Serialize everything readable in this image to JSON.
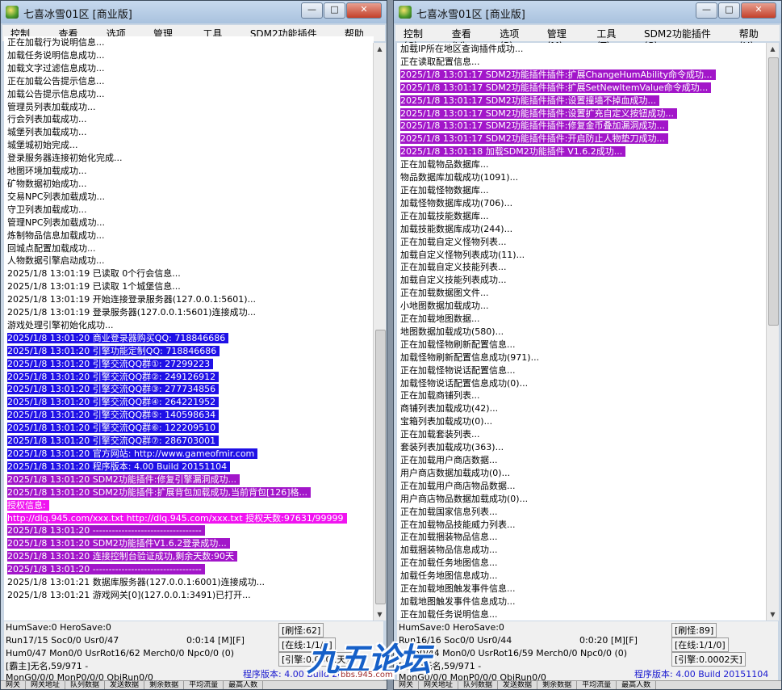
{
  "windows": [
    {
      "title": "七喜冰雪01区 [商业版]",
      "menu": [
        "控制(C)",
        "查看(V)",
        "选项(P)",
        "管理(M)",
        "工具(T)",
        "SDM2功能插件(S)",
        "帮助(H)"
      ],
      "menu_underline": [
        "C",
        "V",
        "P",
        "M",
        "T",
        "S",
        "H"
      ],
      "log": [
        {
          "t": "正在加载行为说明信息...",
          "c": ""
        },
        {
          "t": "加载任务说明信息成功...",
          "c": ""
        },
        {
          "t": "加载文字过滤信息成功...",
          "c": ""
        },
        {
          "t": "正在加载公告提示信息...",
          "c": ""
        },
        {
          "t": "加载公告提示信息成功...",
          "c": ""
        },
        {
          "t": "管理员列表加载成功...",
          "c": ""
        },
        {
          "t": "行会列表加载成功...",
          "c": ""
        },
        {
          "t": "城堡列表加载成功...",
          "c": ""
        },
        {
          "t": "城堡城初始完成...",
          "c": ""
        },
        {
          "t": "登录服务器连接初始化完成...",
          "c": ""
        },
        {
          "t": "地图环境加载成功...",
          "c": ""
        },
        {
          "t": "矿物数据初始成功...",
          "c": ""
        },
        {
          "t": "交易NPC列表加载成功...",
          "c": ""
        },
        {
          "t": "守卫列表加载成功...",
          "c": ""
        },
        {
          "t": "管理NPC列表加载成功...",
          "c": ""
        },
        {
          "t": "炼制物品信息加载成功...",
          "c": ""
        },
        {
          "t": "回城点配置加载成功...",
          "c": ""
        },
        {
          "t": "人物数据引擎启动成功...",
          "c": ""
        },
        {
          "t": "2025/1/8 13:01:19 已读取 0个行会信息...",
          "c": ""
        },
        {
          "t": "2025/1/8 13:01:19 已读取 1个城堡信息...",
          "c": ""
        },
        {
          "t": "2025/1/8 13:01:19 开始连接登录服务器(127.0.0.1:5601)...",
          "c": ""
        },
        {
          "t": "2025/1/8 13:01:19 登录服务器(127.0.0.1:5601)连接成功...",
          "c": ""
        },
        {
          "t": "游戏处理引擎初始化成功...",
          "c": ""
        },
        {
          "t": "2025/1/8 13:01:20 商业登录器购买QQ: 718846686",
          "c": "hl-blue"
        },
        {
          "t": "2025/1/8 13:01:20 引擎功能定制QQ: 718846686",
          "c": "hl-blue"
        },
        {
          "t": "2025/1/8 13:01:20 引擎交流QQ群①: 27299223",
          "c": "hl-blue"
        },
        {
          "t": "2025/1/8 13:01:20 引擎交流QQ群②: 249126912",
          "c": "hl-blue"
        },
        {
          "t": "2025/1/8 13:01:20 引擎交流QQ群③: 277734856",
          "c": "hl-blue"
        },
        {
          "t": "2025/1/8 13:01:20 引擎交流QQ群④: 264221952",
          "c": "hl-blue"
        },
        {
          "t": "2025/1/8 13:01:20 引擎交流QQ群⑤: 140598634",
          "c": "hl-blue"
        },
        {
          "t": "2025/1/8 13:01:20 引擎交流QQ群⑥: 122209510",
          "c": "hl-blue"
        },
        {
          "t": "2025/1/8 13:01:20 引擎交流QQ群⑦: 286703001",
          "c": "hl-blue"
        },
        {
          "t": "2025/1/8 13:01:20 官方网站: http://www.gameofmir.com",
          "c": "hl-blue"
        },
        {
          "t": "2025/1/8 13:01:20 程序版本: 4.00 Build 20151104",
          "c": "hl-blue"
        },
        {
          "t": "2025/1/8 13:01:20 SDM2功能插件:修复引擎漏洞成功...",
          "c": "hl-purple"
        },
        {
          "t": "2025/1/8 13:01:20 SDM2功能插件:扩展背包加载成功,当前背包[126]格...",
          "c": "hl-purple"
        },
        {
          "t": "授权信息:",
          "c": "hl-magenta"
        },
        {
          "t": "http://dlq.945.com/xxx.txt http://dlq.945.com/xxx.txt 授权天数:97631/99999",
          "c": "hl-magenta"
        },
        {
          "t": "2025/1/8 13:01:20 ----------------------------------",
          "c": "hl-purple"
        },
        {
          "t": "2025/1/8 13:01:20 SDM2功能插件V1.6.2登录成功...",
          "c": "hl-purple"
        },
        {
          "t": "2025/1/8 13:01:20 连接控制台验证成功,剩余天数:90天",
          "c": "hl-purple"
        },
        {
          "t": "2025/1/8 13:01:20 ----------------------------------",
          "c": "hl-purple"
        },
        {
          "t": "2025/1/8 13:01:21 数据库服务器(127.0.0.1:6001)连接成功...",
          "c": ""
        },
        {
          "t": "2025/1/8 13:01:21 游戏网关[0](127.0.0.1:3491)已打开...",
          "c": ""
        }
      ],
      "status": {
        "line1": "HumSave:0 HeroSave:0",
        "line2a": "Run17/15 Soc0/0 Usr0/47",
        "line2b": "0:0:14 [M][F]",
        "line3": "Hum0/47 Mon0/0 UsrRot16/62 Merch0/0 Npc0/0 (0)",
        "line4": "[霸主]无名,59/971 -",
        "line5": "MonG0/0/0 MonP0/0/0 ObjRun0/0",
        "box1": "[刷怪:62]",
        "box2": "[在线:1/1/0]",
        "box3": "[引擎:0.0002天]",
        "version": "程序版本: 4.00 Build 20151104"
      },
      "bottom": [
        "网关",
        "网关地址",
        "队列数据",
        "发送数据",
        "剩余数据",
        "平均流量",
        "最高人数"
      ]
    },
    {
      "title": "七喜冰雪01区 [商业版]",
      "menu": [
        "控制(C)",
        "查看(V)",
        "选项(P)",
        "管理(M)",
        "工具(T)",
        "SDM2功能插件(S)",
        "帮助(H)"
      ],
      "menu_underline": [
        "C",
        "V",
        "P",
        "M",
        "T",
        "S",
        "H"
      ],
      "log": [
        {
          "t": "加载IP所在地区查询插件成功...",
          "c": ""
        },
        {
          "t": "正在读取配置信息...",
          "c": ""
        },
        {
          "t": "2025/1/8 13:01:17 SDM2功能插件插件:扩展ChangeHumAbility命令成功...",
          "c": "hl-purple"
        },
        {
          "t": "2025/1/8 13:01:17 SDM2功能插件插件:扩展SetNewItemValue命令成功...",
          "c": "hl-purple"
        },
        {
          "t": "2025/1/8 13:01:17 SDM2功能插件插件:设置撞墙不掉血成功...",
          "c": "hl-purple"
        },
        {
          "t": "2025/1/8 13:01:17 SDM2功能插件插件:设置扩充自定义按钮成功...",
          "c": "hl-purple"
        },
        {
          "t": "2025/1/8 13:01:17 SDM2功能插件插件:修复金币叠加漏洞成功...",
          "c": "hl-purple"
        },
        {
          "t": "2025/1/8 13:01:17 SDM2功能插件插件:开启防止人物垫刀成功...",
          "c": "hl-purple"
        },
        {
          "t": "2025/1/8 13:01:18 加载SDM2功能插件 V1.6.2成功...",
          "c": "hl-purple"
        },
        {
          "t": "正在加载物品数据库...",
          "c": ""
        },
        {
          "t": "物品数据库加载成功(1091)...",
          "c": ""
        },
        {
          "t": "正在加载怪物数据库...",
          "c": ""
        },
        {
          "t": "加载怪物数据库成功(706)...",
          "c": ""
        },
        {
          "t": "正在加载技能数据库...",
          "c": ""
        },
        {
          "t": "加载技能数据库成功(244)...",
          "c": ""
        },
        {
          "t": "正在加载自定义怪物列表...",
          "c": ""
        },
        {
          "t": "加载自定义怪物列表成功(11)...",
          "c": ""
        },
        {
          "t": "正在加载自定义技能列表...",
          "c": ""
        },
        {
          "t": "加载自定义技能列表成功...",
          "c": ""
        },
        {
          "t": "正在加载数据图文件...",
          "c": ""
        },
        {
          "t": "小地图数据加载成功...",
          "c": ""
        },
        {
          "t": "正在加载地图数据...",
          "c": ""
        },
        {
          "t": "地图数据加载成功(580)...",
          "c": ""
        },
        {
          "t": "正在加载怪物刷新配置信息...",
          "c": ""
        },
        {
          "t": "加载怪物刷新配置信息成功(971)...",
          "c": ""
        },
        {
          "t": "正在加载怪物说话配置信息...",
          "c": ""
        },
        {
          "t": "加载怪物说话配置信息成功(0)...",
          "c": ""
        },
        {
          "t": "正在加载商铺列表...",
          "c": ""
        },
        {
          "t": "商铺列表加载成功(42)...",
          "c": ""
        },
        {
          "t": "宝箱列表加载成功(0)...",
          "c": ""
        },
        {
          "t": "正在加载套装列表...",
          "c": ""
        },
        {
          "t": "套装列表加载成功(363)...",
          "c": ""
        },
        {
          "t": "正在加载用户商店数据...",
          "c": ""
        },
        {
          "t": "用户商店数据加载成功(0)...",
          "c": ""
        },
        {
          "t": "正在加载用户商店物品数据...",
          "c": ""
        },
        {
          "t": "用户商店物品数据加载成功(0)...",
          "c": ""
        },
        {
          "t": "正在加载国家信息列表...",
          "c": ""
        },
        {
          "t": "正在加载物品技能威力列表...",
          "c": ""
        },
        {
          "t": "正在加载捆装物品信息...",
          "c": ""
        },
        {
          "t": "加载捆装物品信息成功...",
          "c": ""
        },
        {
          "t": "正在加载任务地图信息...",
          "c": ""
        },
        {
          "t": "加载任务地图信息成功...",
          "c": ""
        },
        {
          "t": "正在加载地图触发事件信息...",
          "c": ""
        },
        {
          "t": "加载地图触发事件信息成功...",
          "c": ""
        },
        {
          "t": "正在加载任务说明信息...",
          "c": ""
        }
      ],
      "status": {
        "line1": "HumSave:0 HeroSave:0",
        "line2a": "Run16/16 Soc0/0 Usr0/44",
        "line2b": "0:0:20 [M][F]",
        "line3": "Hum0/44 Mon0/0 UsrRot16/59 Merch0/0 Npc0/0 (0)",
        "line4": "[霸主]无名,59/971 -",
        "line5": "MonG0/0/0 MonP0/0/0 ObjRun0/0",
        "box1": "[刷怪:89]",
        "box2": "[在线:1/1/0]",
        "box3": "[引擎:0.0002天]",
        "version": "程序版本: 4.00 Build 20151104"
      },
      "bottom": [
        "网关",
        "网关地址",
        "队列数据",
        "发送数据",
        "剩余数据",
        "平均流量",
        "最高人数"
      ]
    }
  ],
  "watermark": {
    "text": "九五论坛",
    "sub": "bbs.945.com"
  },
  "colors": {
    "blue_highlight": "#1f10e6",
    "purple_highlight": "#a216c9",
    "magenta_highlight": "#f014f0"
  }
}
